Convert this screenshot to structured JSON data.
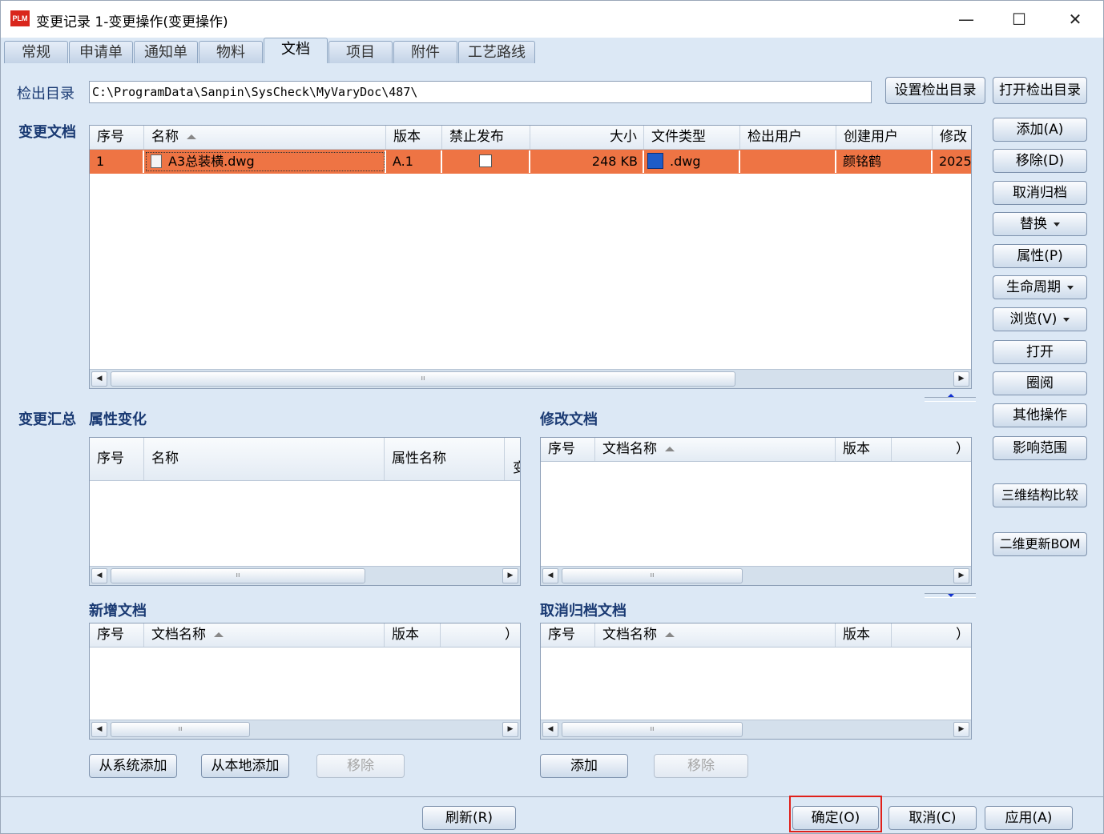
{
  "window": {
    "logo_text": "PLM",
    "title": "变更记录  1-变更操作(变更操作)",
    "minimize": "—",
    "maximize": "☐",
    "close": "✕"
  },
  "tabs": [
    "常规",
    "申请单",
    "通知单",
    "物料",
    "文档",
    "项目",
    "附件",
    "工艺路线"
  ],
  "active_tab": "文档",
  "checkout": {
    "label": "检出目录",
    "path": "C:\\ProgramData\\Sanpin\\SysCheck\\MyVaryDoc\\487\\",
    "set_button": "设置检出目录",
    "open_button": "打开检出目录"
  },
  "change_docs": {
    "label": "变更文档",
    "columns": [
      "序号",
      "名称",
      "版本",
      "禁止发布",
      "大小",
      "文件类型",
      "检出用户",
      "创建用户",
      "修改"
    ],
    "rows": [
      {
        "index": "1",
        "name": "A3总装横.dwg",
        "version": "A.1",
        "forbid_publish": false,
        "size": "248 KB",
        "file_type": ".dwg",
        "checkout_user": "",
        "creator": "颜铭鹤",
        "modified": "2025"
      }
    ]
  },
  "side_buttons": [
    "添加(A)",
    "移除(D)",
    "取消归档",
    "替换",
    "属性(P)",
    "生命周期",
    "浏览(V)",
    "打开",
    "圈阅",
    "其他操作",
    "影响范围",
    "三维结构比较",
    "二维更新BOM"
  ],
  "summary": {
    "label": "变更汇总",
    "attr_change": {
      "label": "属性变化",
      "columns": [
        "序号",
        "名称",
        "属性名称",
        "变"
      ]
    },
    "modify_docs": {
      "label": "修改文档",
      "columns": [
        "序号",
        "文档名称",
        "版本",
        "）"
      ]
    },
    "new_docs": {
      "label": "新增文档",
      "columns": [
        "序号",
        "文档名称",
        "版本",
        "）"
      ]
    },
    "cancel_docs": {
      "label": "取消归档文档",
      "columns": [
        "序号",
        "文档名称",
        "版本",
        "）"
      ]
    },
    "scroll_grip": "ıı"
  },
  "lower_buttons": {
    "add_from_system": "从系统添加",
    "add_from_local": "从本地添加",
    "remove_left": "移除",
    "add": "添加",
    "remove_right": "移除"
  },
  "footer": {
    "refresh": "刷新(R)",
    "ok": "确定(O)",
    "cancel": "取消(C)",
    "apply": "应用(A)"
  },
  "colors": {
    "selected_row": "#ee7444",
    "highlight_box": "#e0201a",
    "label_text": "#1a3a73",
    "panel_bg": "#dce8f5"
  }
}
